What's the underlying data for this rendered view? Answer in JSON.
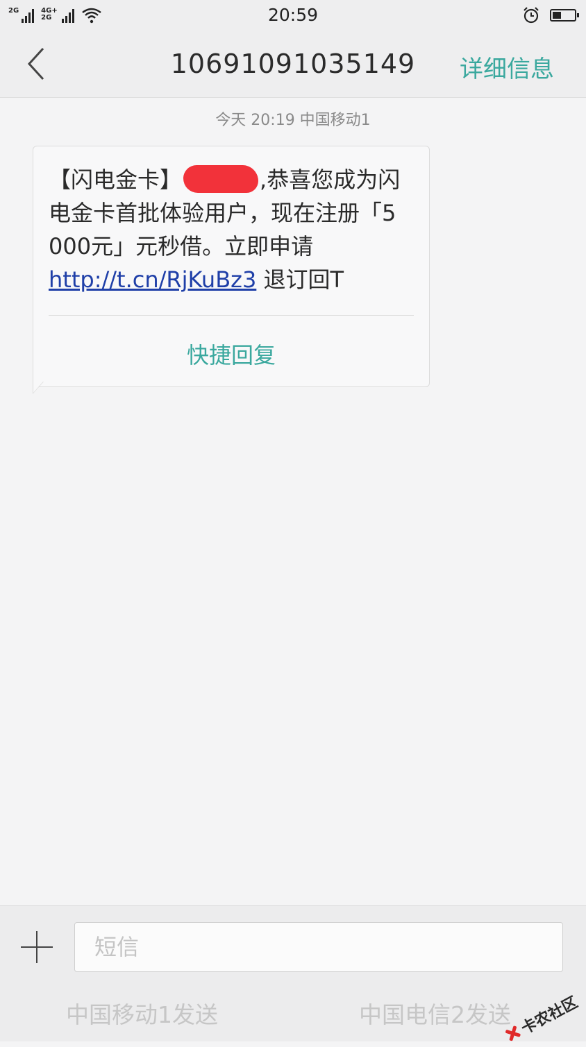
{
  "status_bar": {
    "network_1": "2G",
    "network_2_top": "4G+",
    "network_2_bottom": "2G",
    "time": "20:59",
    "battery_level": 0.4,
    "icons": [
      "signal-icon",
      "wifi-icon",
      "alarm-icon",
      "battery-icon"
    ]
  },
  "header": {
    "title": "10691091035149",
    "detail_label": "详细信息",
    "back_icon": "chevron-left-icon"
  },
  "thread": {
    "timestamp": "今天  20:19  中国移动1",
    "message": {
      "text_before_redaction": "【闪电金卡】",
      "text_after_redaction": ",恭喜您成为闪电金卡首批体验用户，现在注册「5000元」元秒借。立即申请",
      "link": "http://t.cn/RjKuBz3",
      "text_after_link": " 退订回T"
    },
    "quick_reply_label": "快捷回复"
  },
  "composer": {
    "plus_icon": "plus-icon",
    "placeholder": "短信",
    "send_sim1_label": "中国移动1发送",
    "send_sim2_label": "中国电信2发送"
  },
  "watermark": {
    "text": "卡农社区"
  },
  "colors": {
    "accent": "#3aa89e",
    "link": "#1f3fa8",
    "redaction": "#f2323a"
  }
}
